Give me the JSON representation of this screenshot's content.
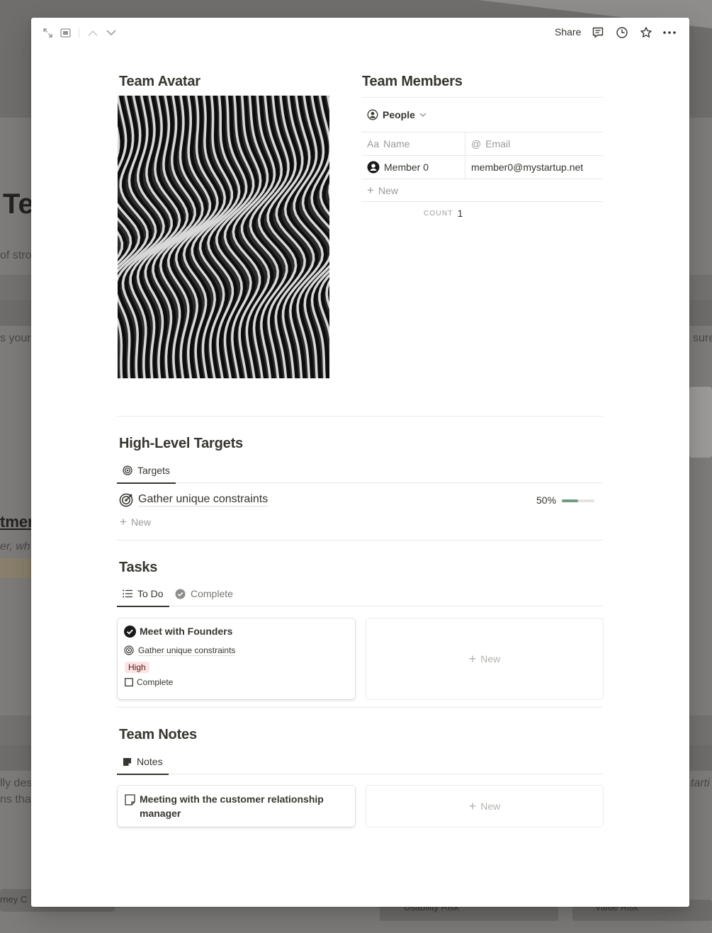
{
  "background": {
    "title_fragment": "Te",
    "frag1": "of stron",
    "frag2": "s your",
    "frag3": "sure",
    "frag4": "tmer",
    "frag5": "er, wh",
    "frag6": "lly des",
    "frag7": "ns tha",
    "frag8": "tarti",
    "frag9": "rney C",
    "frag10": "Usability Risk",
    "frag11": "Value Risk"
  },
  "topbar": {
    "share_label": "Share",
    "icons": [
      "expand-icon",
      "peek-mode-icon",
      "chevron-up-icon",
      "chevron-down-icon",
      "comment-icon",
      "history-icon",
      "star-icon",
      "more-icon"
    ]
  },
  "team_avatar": {
    "title": "Team Avatar"
  },
  "team_members": {
    "title": "Team Members",
    "view_label": "People",
    "columns": {
      "name": "Name",
      "email": "Email"
    },
    "column_prefix": {
      "name": "Aa",
      "email": "@"
    },
    "rows": [
      {
        "name": "Member 0",
        "email": "member0@mystartup.net"
      }
    ],
    "new_label": "New",
    "count_label": "COUNT",
    "count_value": "1"
  },
  "targets": {
    "title": "High-Level Targets",
    "tab_label": "Targets",
    "items": [
      {
        "name": "Gather unique constraints",
        "progress_label": "50%",
        "progress": 0.5
      }
    ],
    "new_label": "New"
  },
  "tasks": {
    "title": "Tasks",
    "tabs": [
      {
        "label": "To Do"
      },
      {
        "label": "Complete"
      }
    ],
    "cards": [
      {
        "title": "Meet with Founders",
        "target": "Gather unique constraints",
        "priority": "High",
        "status": "Complete"
      }
    ],
    "new_label": "New"
  },
  "notes": {
    "title": "Team Notes",
    "tab_label": "Notes",
    "cards": [
      {
        "title": "Meeting with the customer relationship manager"
      }
    ],
    "new_label": "New"
  },
  "colors": {
    "accent_progress": "#6c9b7d",
    "priority_high_bg": "#fbe4e4",
    "text": "#37352f"
  }
}
